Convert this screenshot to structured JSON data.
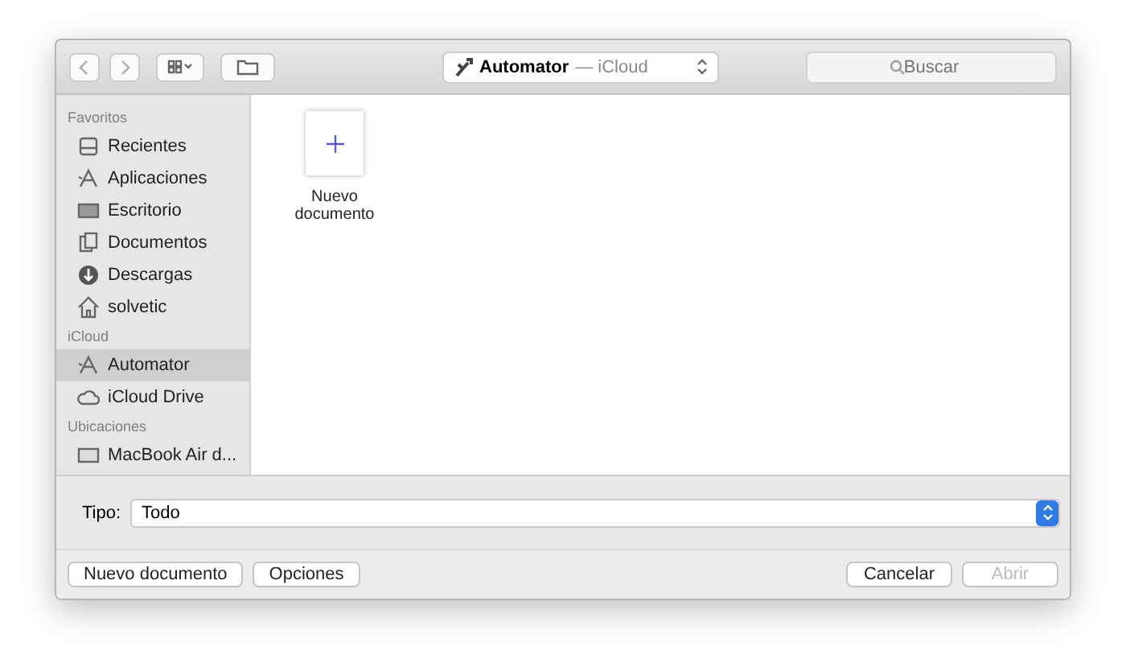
{
  "toolbar": {
    "location": {
      "name": "Automator",
      "place": "— iCloud"
    },
    "search": {
      "placeholder": "Buscar"
    }
  },
  "sidebar": {
    "sections": [
      {
        "heading": "Favoritos",
        "items": [
          {
            "label": "Recientes",
            "kind": "recents",
            "selected": false
          },
          {
            "label": "Aplicaciones",
            "kind": "apps",
            "selected": false
          },
          {
            "label": "Escritorio",
            "kind": "desktop",
            "selected": false
          },
          {
            "label": "Documentos",
            "kind": "documents",
            "selected": false
          },
          {
            "label": "Descargas",
            "kind": "downloads",
            "selected": false
          },
          {
            "label": "solvetic",
            "kind": "home",
            "selected": false
          }
        ]
      },
      {
        "heading": "iCloud",
        "items": [
          {
            "label": "Automator",
            "kind": "apps",
            "selected": true
          },
          {
            "label": "iCloud Drive",
            "kind": "cloud",
            "selected": false
          }
        ]
      },
      {
        "heading": "Ubicaciones",
        "items": [
          {
            "label": "MacBook Air d...",
            "kind": "laptop",
            "selected": false
          }
        ]
      }
    ]
  },
  "files": [
    {
      "label": "Nuevo documento"
    }
  ],
  "type_bar": {
    "label": "Tipo:",
    "value": "Todo"
  },
  "buttons_left": [
    {
      "label": "Nuevo documento",
      "disabled": false
    },
    {
      "label": "Opciones",
      "disabled": false
    }
  ],
  "buttons_right": [
    {
      "label": "Cancelar",
      "disabled": false
    },
    {
      "label": "Abrir",
      "disabled": true
    }
  ]
}
